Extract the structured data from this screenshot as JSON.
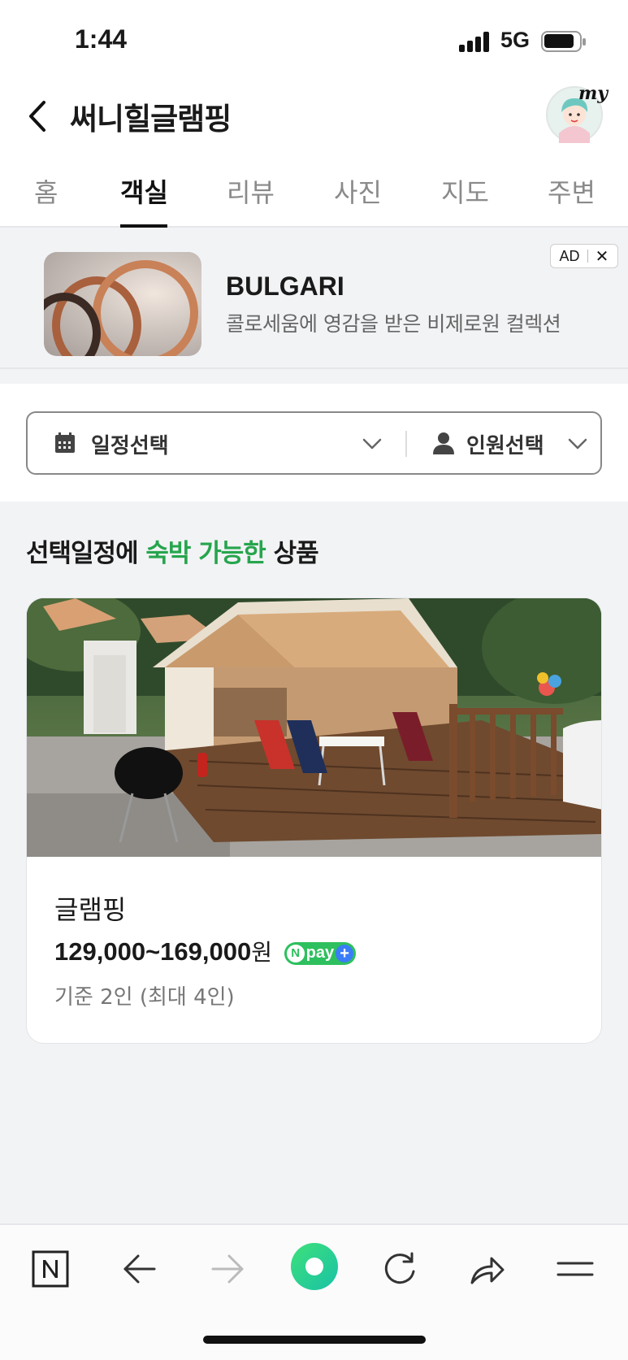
{
  "status": {
    "time": "1:44",
    "network": "5G"
  },
  "header": {
    "title": "써니힐글램핑",
    "avatar_label": "my",
    "tabs": [
      {
        "label": "홈",
        "active": false
      },
      {
        "label": "객실",
        "active": true
      },
      {
        "label": "리뷰",
        "active": false
      },
      {
        "label": "사진",
        "active": false
      },
      {
        "label": "지도",
        "active": false
      },
      {
        "label": "주변",
        "active": false
      }
    ]
  },
  "ad": {
    "brand": "BULGARI",
    "subtitle": "콜로세움에 영감을 받은 비제로원 컬렉션",
    "badge": "AD",
    "close": "✕"
  },
  "filters": {
    "date_label": "일정선택",
    "people_label": "인원선택"
  },
  "section": {
    "prefix": "선택일정에 ",
    "highlight": "숙박 가능한",
    "suffix": " 상품",
    "highlight_color": "#26a54d"
  },
  "listing": {
    "name": "글램핑",
    "price": "129,000~169,000",
    "currency": "원",
    "npay_label": "pay",
    "capacity": "기준 2인 (최대 4인)"
  },
  "bottom_nav": [
    "naver-home",
    "back",
    "forward",
    "green-dot",
    "refresh",
    "share",
    "menu"
  ]
}
